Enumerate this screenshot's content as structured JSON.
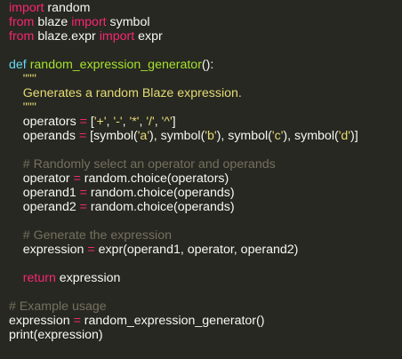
{
  "editor": {
    "colors": {
      "background": "#272822",
      "text": "#f8f8f2",
      "keyword": "#f92672",
      "def_keyword": "#66d9ef",
      "function_name": "#a6e22e",
      "string": "#e6db74",
      "comment": "#75715e"
    },
    "lines": [
      [
        {
          "t": "import",
          "c": "kw"
        },
        {
          "t": " random",
          "c": "plain"
        }
      ],
      [
        {
          "t": "from",
          "c": "kw"
        },
        {
          "t": " blaze ",
          "c": "plain"
        },
        {
          "t": "import",
          "c": "kw"
        },
        {
          "t": " symbol",
          "c": "plain"
        }
      ],
      [
        {
          "t": "from",
          "c": "kw"
        },
        {
          "t": " blaze.expr ",
          "c": "plain"
        },
        {
          "t": "import",
          "c": "kw"
        },
        {
          "t": " expr",
          "c": "plain"
        }
      ],
      [],
      [
        {
          "t": "def",
          "c": "def"
        },
        {
          "t": " ",
          "c": "plain"
        },
        {
          "t": "random_expression_generator",
          "c": "fn"
        },
        {
          "t": "():",
          "c": "plain"
        }
      ],
      [
        {
          "t": "    \"\"\"",
          "c": "str"
        }
      ],
      [
        {
          "t": "    Generates a random Blaze expression.",
          "c": "str"
        }
      ],
      [
        {
          "t": "    \"\"\"",
          "c": "str"
        }
      ],
      [
        {
          "t": "    operators ",
          "c": "plain"
        },
        {
          "t": "=",
          "c": "kw"
        },
        {
          "t": " [",
          "c": "plain"
        },
        {
          "t": "'+'",
          "c": "str"
        },
        {
          "t": ", ",
          "c": "plain"
        },
        {
          "t": "'-'",
          "c": "str"
        },
        {
          "t": ", ",
          "c": "plain"
        },
        {
          "t": "'*'",
          "c": "str"
        },
        {
          "t": ", ",
          "c": "plain"
        },
        {
          "t": "'/'",
          "c": "str"
        },
        {
          "t": ", ",
          "c": "plain"
        },
        {
          "t": "'^'",
          "c": "str"
        },
        {
          "t": "]",
          "c": "plain"
        }
      ],
      [
        {
          "t": "    operands ",
          "c": "plain"
        },
        {
          "t": "=",
          "c": "kw"
        },
        {
          "t": " [symbol(",
          "c": "plain"
        },
        {
          "t": "'a'",
          "c": "str"
        },
        {
          "t": "), symbol(",
          "c": "plain"
        },
        {
          "t": "'b'",
          "c": "str"
        },
        {
          "t": "), symbol(",
          "c": "plain"
        },
        {
          "t": "'c'",
          "c": "str"
        },
        {
          "t": "), symbol(",
          "c": "plain"
        },
        {
          "t": "'d'",
          "c": "str"
        },
        {
          "t": ")]",
          "c": "plain"
        }
      ],
      [],
      [
        {
          "t": "    # Randomly select an operator and operands",
          "c": "cm"
        }
      ],
      [
        {
          "t": "    operator ",
          "c": "plain"
        },
        {
          "t": "=",
          "c": "kw"
        },
        {
          "t": " random.choice(operators)",
          "c": "plain"
        }
      ],
      [
        {
          "t": "    operand1 ",
          "c": "plain"
        },
        {
          "t": "=",
          "c": "kw"
        },
        {
          "t": " random.choice(operands)",
          "c": "plain"
        }
      ],
      [
        {
          "t": "    operand2 ",
          "c": "plain"
        },
        {
          "t": "=",
          "c": "kw"
        },
        {
          "t": " random.choice(operands)",
          "c": "plain"
        }
      ],
      [],
      [
        {
          "t": "    # Generate the expression",
          "c": "cm"
        }
      ],
      [
        {
          "t": "    expression ",
          "c": "plain"
        },
        {
          "t": "=",
          "c": "kw"
        },
        {
          "t": " expr(operand1, operator, operand2)",
          "c": "plain"
        }
      ],
      [],
      [
        {
          "t": "    ",
          "c": "plain"
        },
        {
          "t": "return",
          "c": "kw"
        },
        {
          "t": " expression",
          "c": "plain"
        }
      ],
      [],
      [
        {
          "t": "# Example usage",
          "c": "cm"
        }
      ],
      [
        {
          "t": "expression ",
          "c": "plain"
        },
        {
          "t": "=",
          "c": "kw"
        },
        {
          "t": " random_expression_generator()",
          "c": "plain"
        }
      ],
      [
        {
          "t": "print(expression)",
          "c": "plain"
        }
      ]
    ]
  }
}
